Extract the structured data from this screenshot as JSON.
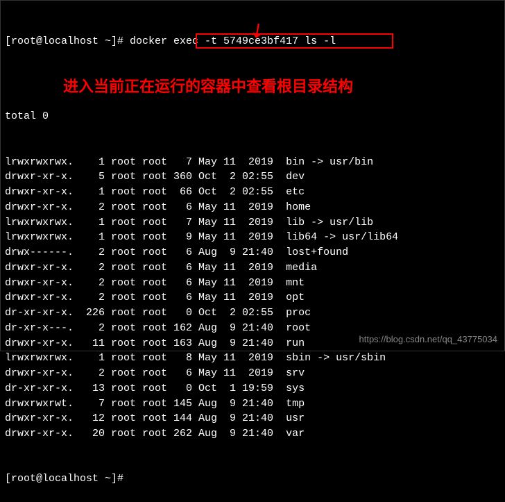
{
  "prompt_prefix": "[root@localhost ~]# ",
  "command": "docker exec -t 5749ce3bf417 ls -l",
  "total_line": "total 0",
  "rows": [
    {
      "perms": "lrwxrwxrwx.",
      "links": "1",
      "owner": "root",
      "group": "root",
      "size": "7",
      "month": "May",
      "day": "11",
      "time": "2019",
      "name": "bin -> usr/bin"
    },
    {
      "perms": "drwxr-xr-x.",
      "links": "5",
      "owner": "root",
      "group": "root",
      "size": "360",
      "month": "Oct",
      "day": "2",
      "time": "02:55",
      "name": "dev"
    },
    {
      "perms": "drwxr-xr-x.",
      "links": "1",
      "owner": "root",
      "group": "root",
      "size": "66",
      "month": "Oct",
      "day": "2",
      "time": "02:55",
      "name": "etc"
    },
    {
      "perms": "drwxr-xr-x.",
      "links": "2",
      "owner": "root",
      "group": "root",
      "size": "6",
      "month": "May",
      "day": "11",
      "time": "2019",
      "name": "home"
    },
    {
      "perms": "lrwxrwxrwx.",
      "links": "1",
      "owner": "root",
      "group": "root",
      "size": "7",
      "month": "May",
      "day": "11",
      "time": "2019",
      "name": "lib -> usr/lib"
    },
    {
      "perms": "lrwxrwxrwx.",
      "links": "1",
      "owner": "root",
      "group": "root",
      "size": "9",
      "month": "May",
      "day": "11",
      "time": "2019",
      "name": "lib64 -> usr/lib64"
    },
    {
      "perms": "drwx------.",
      "links": "2",
      "owner": "root",
      "group": "root",
      "size": "6",
      "month": "Aug",
      "day": "9",
      "time": "21:40",
      "name": "lost+found"
    },
    {
      "perms": "drwxr-xr-x.",
      "links": "2",
      "owner": "root",
      "group": "root",
      "size": "6",
      "month": "May",
      "day": "11",
      "time": "2019",
      "name": "media"
    },
    {
      "perms": "drwxr-xr-x.",
      "links": "2",
      "owner": "root",
      "group": "root",
      "size": "6",
      "month": "May",
      "day": "11",
      "time": "2019",
      "name": "mnt"
    },
    {
      "perms": "drwxr-xr-x.",
      "links": "2",
      "owner": "root",
      "group": "root",
      "size": "6",
      "month": "May",
      "day": "11",
      "time": "2019",
      "name": "opt"
    },
    {
      "perms": "dr-xr-xr-x.",
      "links": "226",
      "owner": "root",
      "group": "root",
      "size": "0",
      "month": "Oct",
      "day": "2",
      "time": "02:55",
      "name": "proc"
    },
    {
      "perms": "dr-xr-x---.",
      "links": "2",
      "owner": "root",
      "group": "root",
      "size": "162",
      "month": "Aug",
      "day": "9",
      "time": "21:40",
      "name": "root"
    },
    {
      "perms": "drwxr-xr-x.",
      "links": "11",
      "owner": "root",
      "group": "root",
      "size": "163",
      "month": "Aug",
      "day": "9",
      "time": "21:40",
      "name": "run"
    },
    {
      "perms": "lrwxrwxrwx.",
      "links": "1",
      "owner": "root",
      "group": "root",
      "size": "8",
      "month": "May",
      "day": "11",
      "time": "2019",
      "name": "sbin -> usr/sbin"
    },
    {
      "perms": "drwxr-xr-x.",
      "links": "2",
      "owner": "root",
      "group": "root",
      "size": "6",
      "month": "May",
      "day": "11",
      "time": "2019",
      "name": "srv"
    },
    {
      "perms": "dr-xr-xr-x.",
      "links": "13",
      "owner": "root",
      "group": "root",
      "size": "0",
      "month": "Oct",
      "day": "1",
      "time": "19:59",
      "name": "sys"
    },
    {
      "perms": "drwxrwxrwt.",
      "links": "7",
      "owner": "root",
      "group": "root",
      "size": "145",
      "month": "Aug",
      "day": "9",
      "time": "21:40",
      "name": "tmp"
    },
    {
      "perms": "drwxr-xr-x.",
      "links": "12",
      "owner": "root",
      "group": "root",
      "size": "144",
      "month": "Aug",
      "day": "9",
      "time": "21:40",
      "name": "usr"
    },
    {
      "perms": "drwxr-xr-x.",
      "links": "20",
      "owner": "root",
      "group": "root",
      "size": "262",
      "month": "Aug",
      "day": "9",
      "time": "21:40",
      "name": "var"
    }
  ],
  "prompt_end": "[root@localhost ~]# ",
  "annotation_text": "进入当前正在运行的容器中查看根目录结构",
  "watermark_text": "https://blog.csdn.net/qq_43775034"
}
